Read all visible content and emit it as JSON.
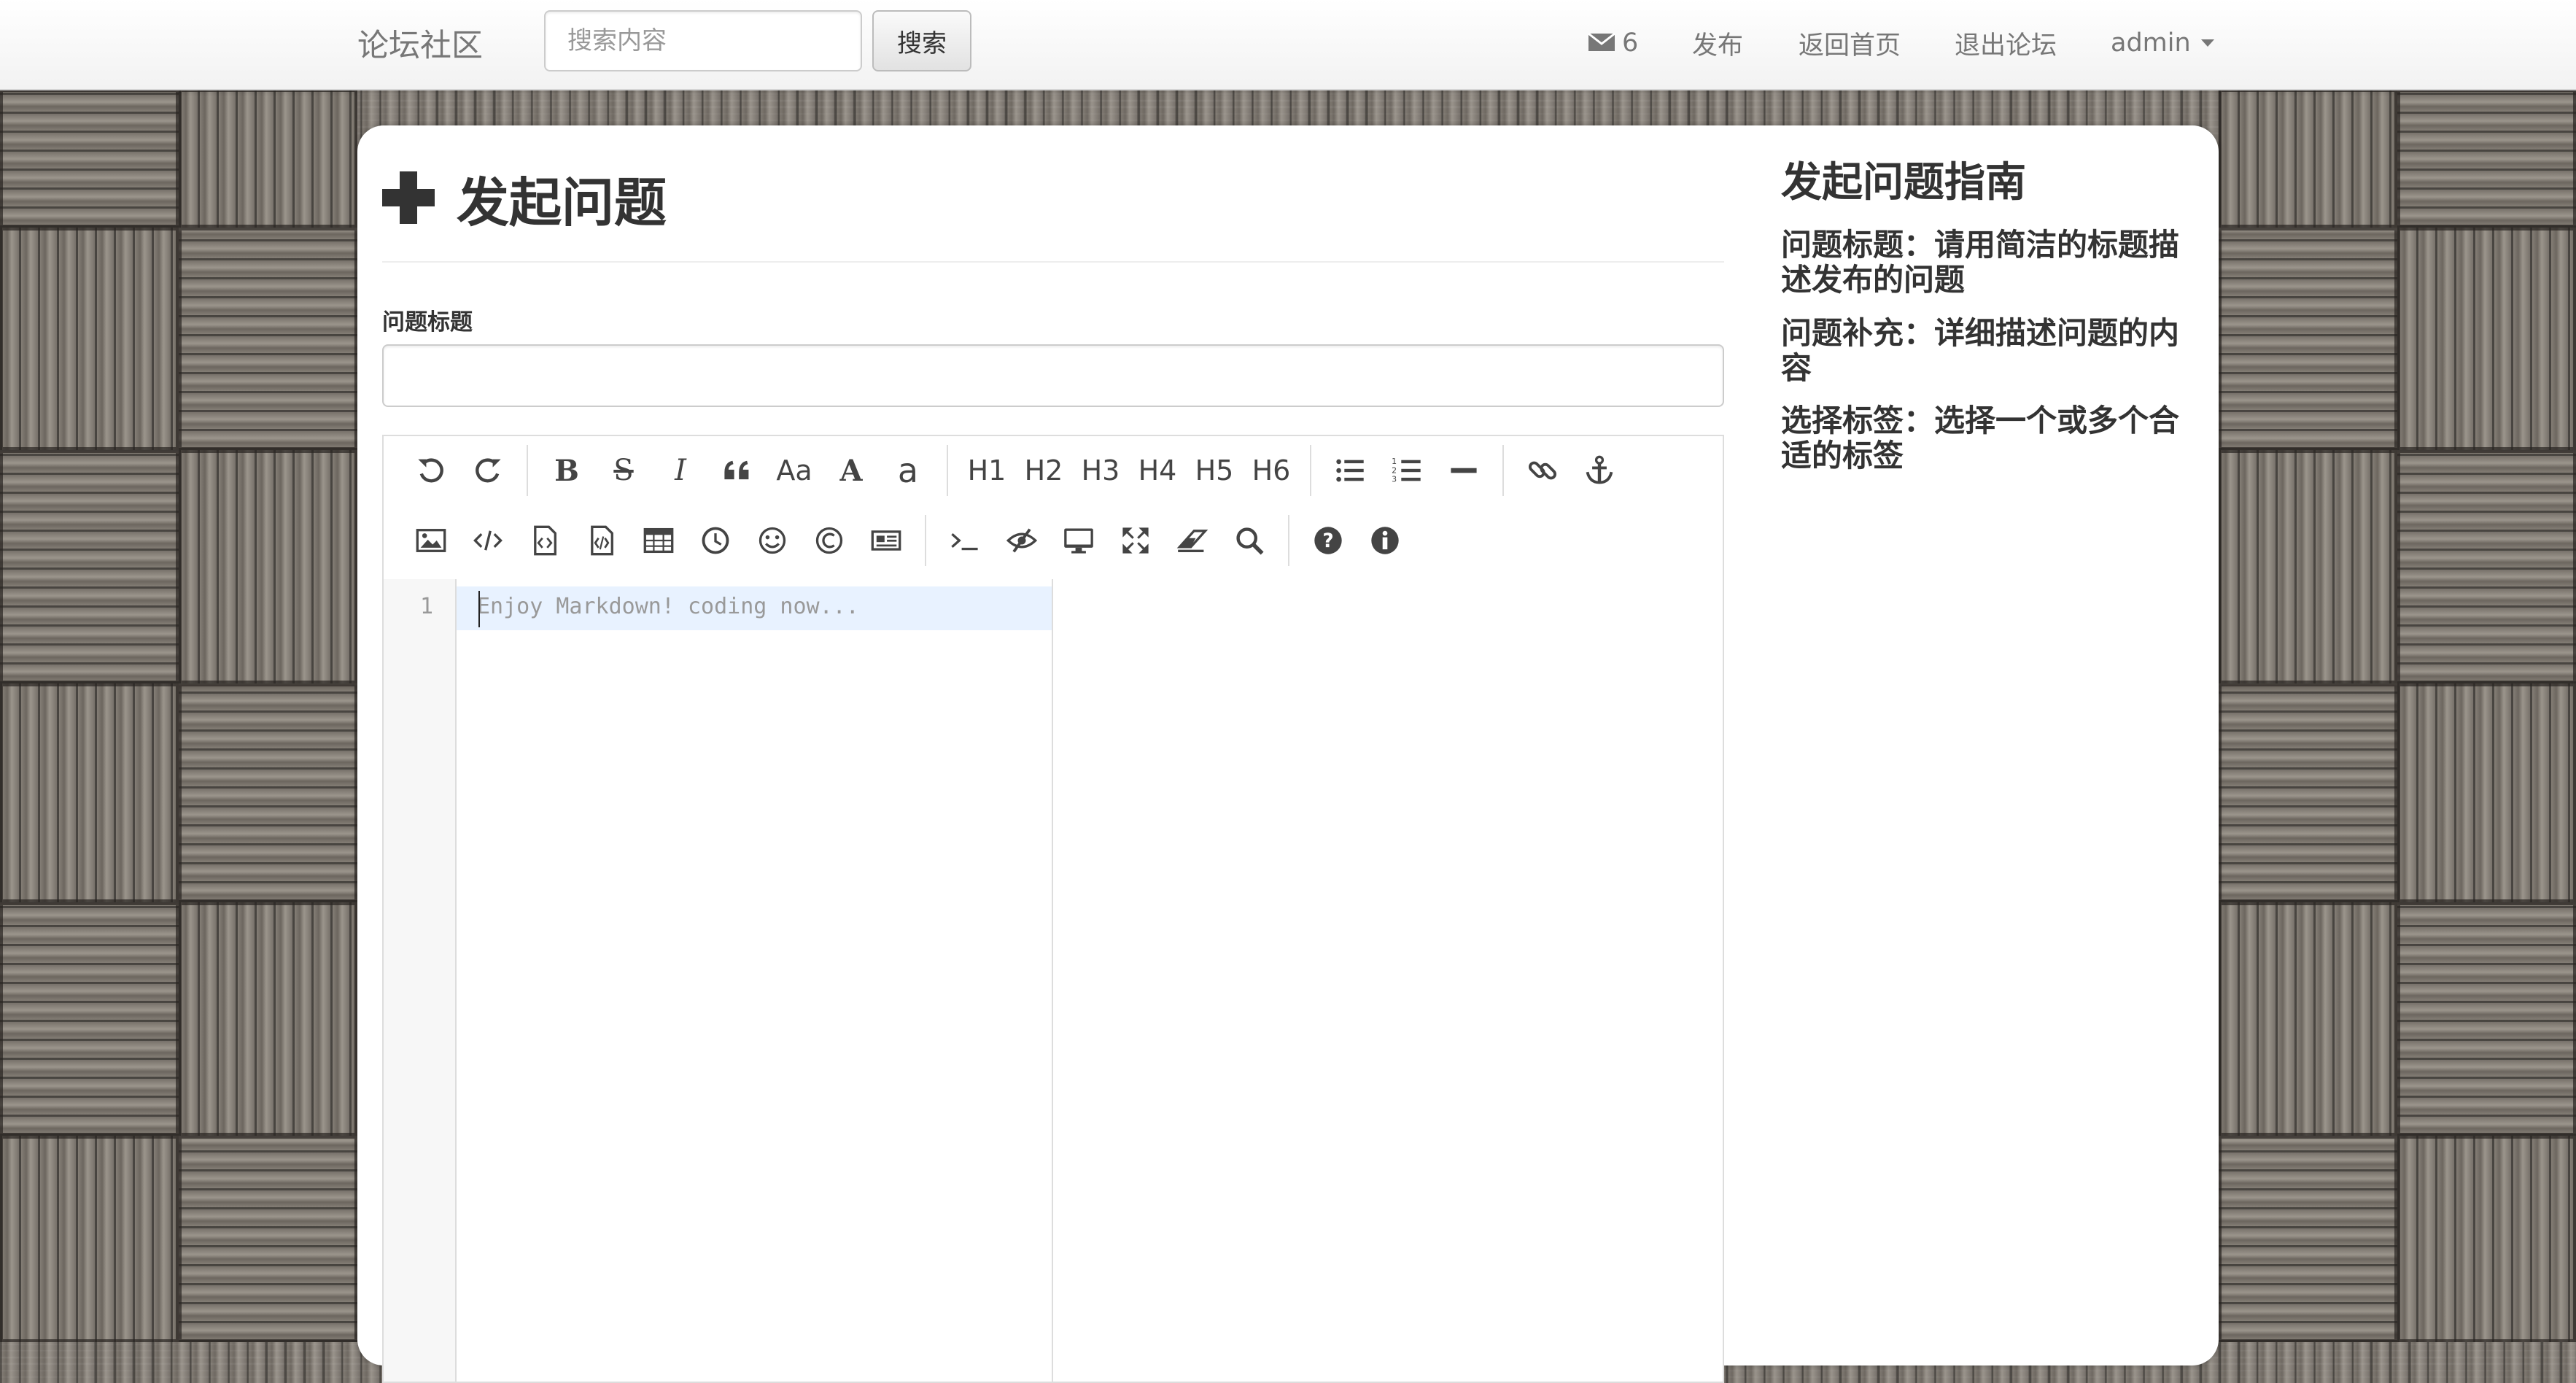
{
  "navbar": {
    "brand": "论坛社区",
    "search_placeholder": "搜索内容",
    "search_button": "搜索",
    "messages_count": "6",
    "publish": "发布",
    "home": "返回首页",
    "logout": "退出论坛",
    "user": "admin"
  },
  "page": {
    "title": "发起问题",
    "title_label": "问题标题"
  },
  "editor": {
    "toolbar_row1": [
      {
        "name": "undo-icon",
        "icon": "undo"
      },
      {
        "name": "redo-icon",
        "icon": "redo"
      },
      {
        "sep": true
      },
      {
        "name": "bold-icon",
        "label": "B",
        "style": "serif-bold"
      },
      {
        "name": "strikethrough-icon",
        "label": "S",
        "style": "serif-strike"
      },
      {
        "name": "italic-icon",
        "label": "I",
        "style": "serif-italic"
      },
      {
        "name": "quote-icon",
        "icon": "quote"
      },
      {
        "name": "uppercase-first-icon",
        "label": "Aa",
        "style": "sans"
      },
      {
        "name": "uppercase-icon",
        "label": "A",
        "style": "serif"
      },
      {
        "name": "lowercase-icon",
        "label": "a",
        "style": "sans-light"
      },
      {
        "sep": true
      },
      {
        "name": "h1-button",
        "label": "H1",
        "style": "sans"
      },
      {
        "name": "h2-button",
        "label": "H2",
        "style": "sans"
      },
      {
        "name": "h3-button",
        "label": "H3",
        "style": "sans"
      },
      {
        "name": "h4-button",
        "label": "H4",
        "style": "sans"
      },
      {
        "name": "h5-button",
        "label": "H5",
        "style": "sans"
      },
      {
        "name": "h6-button",
        "label": "H6",
        "style": "sans"
      },
      {
        "sep": true
      },
      {
        "name": "unordered-list-icon",
        "icon": "ul"
      },
      {
        "name": "ordered-list-icon",
        "icon": "ol"
      },
      {
        "name": "horizontal-rule-icon",
        "icon": "hr"
      },
      {
        "sep": true
      },
      {
        "name": "link-icon",
        "icon": "link"
      },
      {
        "name": "anchor-icon",
        "icon": "anchor"
      }
    ],
    "toolbar_row2": [
      {
        "name": "image-icon",
        "icon": "image"
      },
      {
        "name": "inline-code-icon",
        "icon": "code"
      },
      {
        "name": "code-block-icon",
        "icon": "file-code"
      },
      {
        "name": "preformatted-text-icon",
        "icon": "file-code2"
      },
      {
        "name": "table-icon",
        "icon": "table"
      },
      {
        "name": "datetime-icon",
        "icon": "clock"
      },
      {
        "name": "emoji-icon",
        "icon": "smile"
      },
      {
        "name": "html-entities-icon",
        "icon": "copyright"
      },
      {
        "name": "pagebreak-icon",
        "icon": "newspaper"
      },
      {
        "sep": true
      },
      {
        "name": "goto-line-icon",
        "icon": "terminal"
      },
      {
        "name": "toggle-preview-icon",
        "icon": "eye-slash"
      },
      {
        "name": "fullscreen-preview-icon",
        "icon": "desktop"
      },
      {
        "name": "fullscreen-icon",
        "icon": "arrows"
      },
      {
        "name": "clear-icon",
        "icon": "eraser"
      },
      {
        "name": "search-replace-icon",
        "icon": "search"
      },
      {
        "sep": true
      },
      {
        "name": "help-icon",
        "icon": "question"
      },
      {
        "name": "info-icon",
        "icon": "info"
      }
    ],
    "line_number": "1",
    "placeholder": "Enjoy Markdown! coding now..."
  },
  "guide": {
    "title": "发起问题指南",
    "items": [
      "问题标题：请用简洁的标题描述发布的问题",
      "问题补充：详细描述问题的内容",
      "选择标签：选择一个或多个合适的标签"
    ]
  }
}
